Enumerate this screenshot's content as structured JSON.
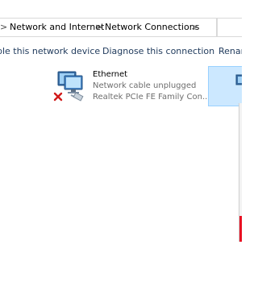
{
  "breadcrumb": {
    "items": [
      "Network and Internet",
      "Network Connections"
    ],
    "separator": ">"
  },
  "command_bar": {
    "disable_label": "ble this network device",
    "diagnose_label": "Diagnose this connection",
    "rename_label": "Renam"
  },
  "connection": {
    "name": "Ethernet",
    "status": "Network cable unplugged",
    "device": "Realtek PCIe FE Family Con...",
    "icon": "network-adapter-icon",
    "error_icon": "red-x-icon"
  },
  "colors": {
    "selection_bg": "#cce8ff",
    "selection_border": "#99d1ff",
    "command_text": "#1e395b",
    "status_text": "#6d6d6d",
    "error_red": "#e81123"
  }
}
